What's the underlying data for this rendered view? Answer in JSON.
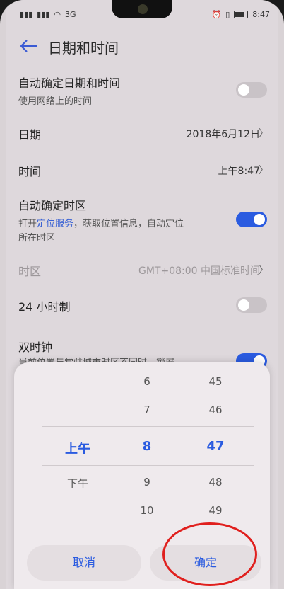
{
  "status": {
    "signal_text": "3G",
    "time": "8:47"
  },
  "header": {
    "title": "日期和时间"
  },
  "rows": {
    "auto_datetime": {
      "label": "自动确定日期和时间",
      "sub": "使用网络上的时间"
    },
    "date": {
      "label": "日期",
      "value": "2018年6月12日"
    },
    "time": {
      "label": "时间",
      "value": "上午8:47"
    },
    "auto_tz": {
      "label": "自动确定时区",
      "sub_prefix": "打开",
      "sub_link": "定位服务",
      "sub_suffix": "，获取位置信息，自动定位",
      "sub_line2": "所在时区"
    },
    "timezone": {
      "label": "时区",
      "value": "GMT+08:00 中国标准时间"
    },
    "h24": {
      "label": "24 小时制"
    },
    "dual": {
      "label": "双时钟",
      "sub": "当前位置与常驻城市时区不同时，锁屏"
    }
  },
  "picker": {
    "ampm": [
      "上午",
      "下午"
    ],
    "hours": [
      "6",
      "7",
      "8",
      "9",
      "10"
    ],
    "minutes": [
      "45",
      "46",
      "47",
      "48",
      "49"
    ],
    "cancel_label": "取消",
    "confirm_label": "确定"
  },
  "toggles": {
    "auto_datetime": false,
    "auto_tz": true,
    "h24": false,
    "dual": true
  },
  "colors": {
    "accent": "#2a5be0",
    "highlight_circle": "#e0201e"
  }
}
